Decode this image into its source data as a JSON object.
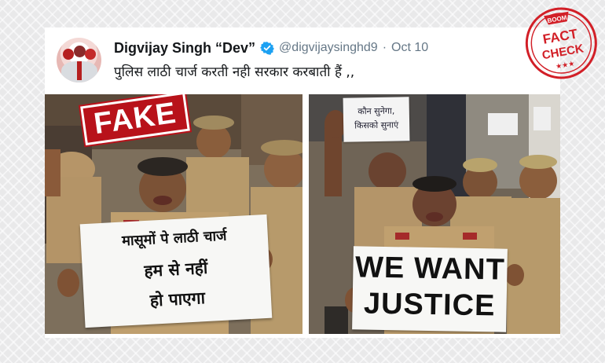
{
  "tweet": {
    "display_name": "Digvijay Singh “Dev”",
    "handle": "@digvijaysinghd9",
    "separator": "·",
    "date": "Oct 10",
    "text": "पुलिस लाठी चार्ज करती नही सरकार करबाती हैं ,,"
  },
  "left_photo": {
    "stamp": "FAKE",
    "placard_lines": [
      "मासूमों पे लाठी चार्ज",
      "हम से नहीं",
      "हो पाएगा"
    ]
  },
  "right_photo": {
    "small_sign_lines": [
      "कौन सुनेगा,",
      "किसको सुनाएं"
    ],
    "placard_lines": [
      "WE WANT",
      "JUSTICE"
    ]
  },
  "badge": {
    "top": "BOOM",
    "word1": "FACT",
    "word2": "CHECK",
    "stars": "★★★"
  },
  "colors": {
    "stamp_red": "#b8121a",
    "verified_blue": "#1da1f2",
    "uniform_khaki": "#b79a6b",
    "handle_gray": "#657786"
  },
  "icons": [
    "verified-badge-icon"
  ]
}
